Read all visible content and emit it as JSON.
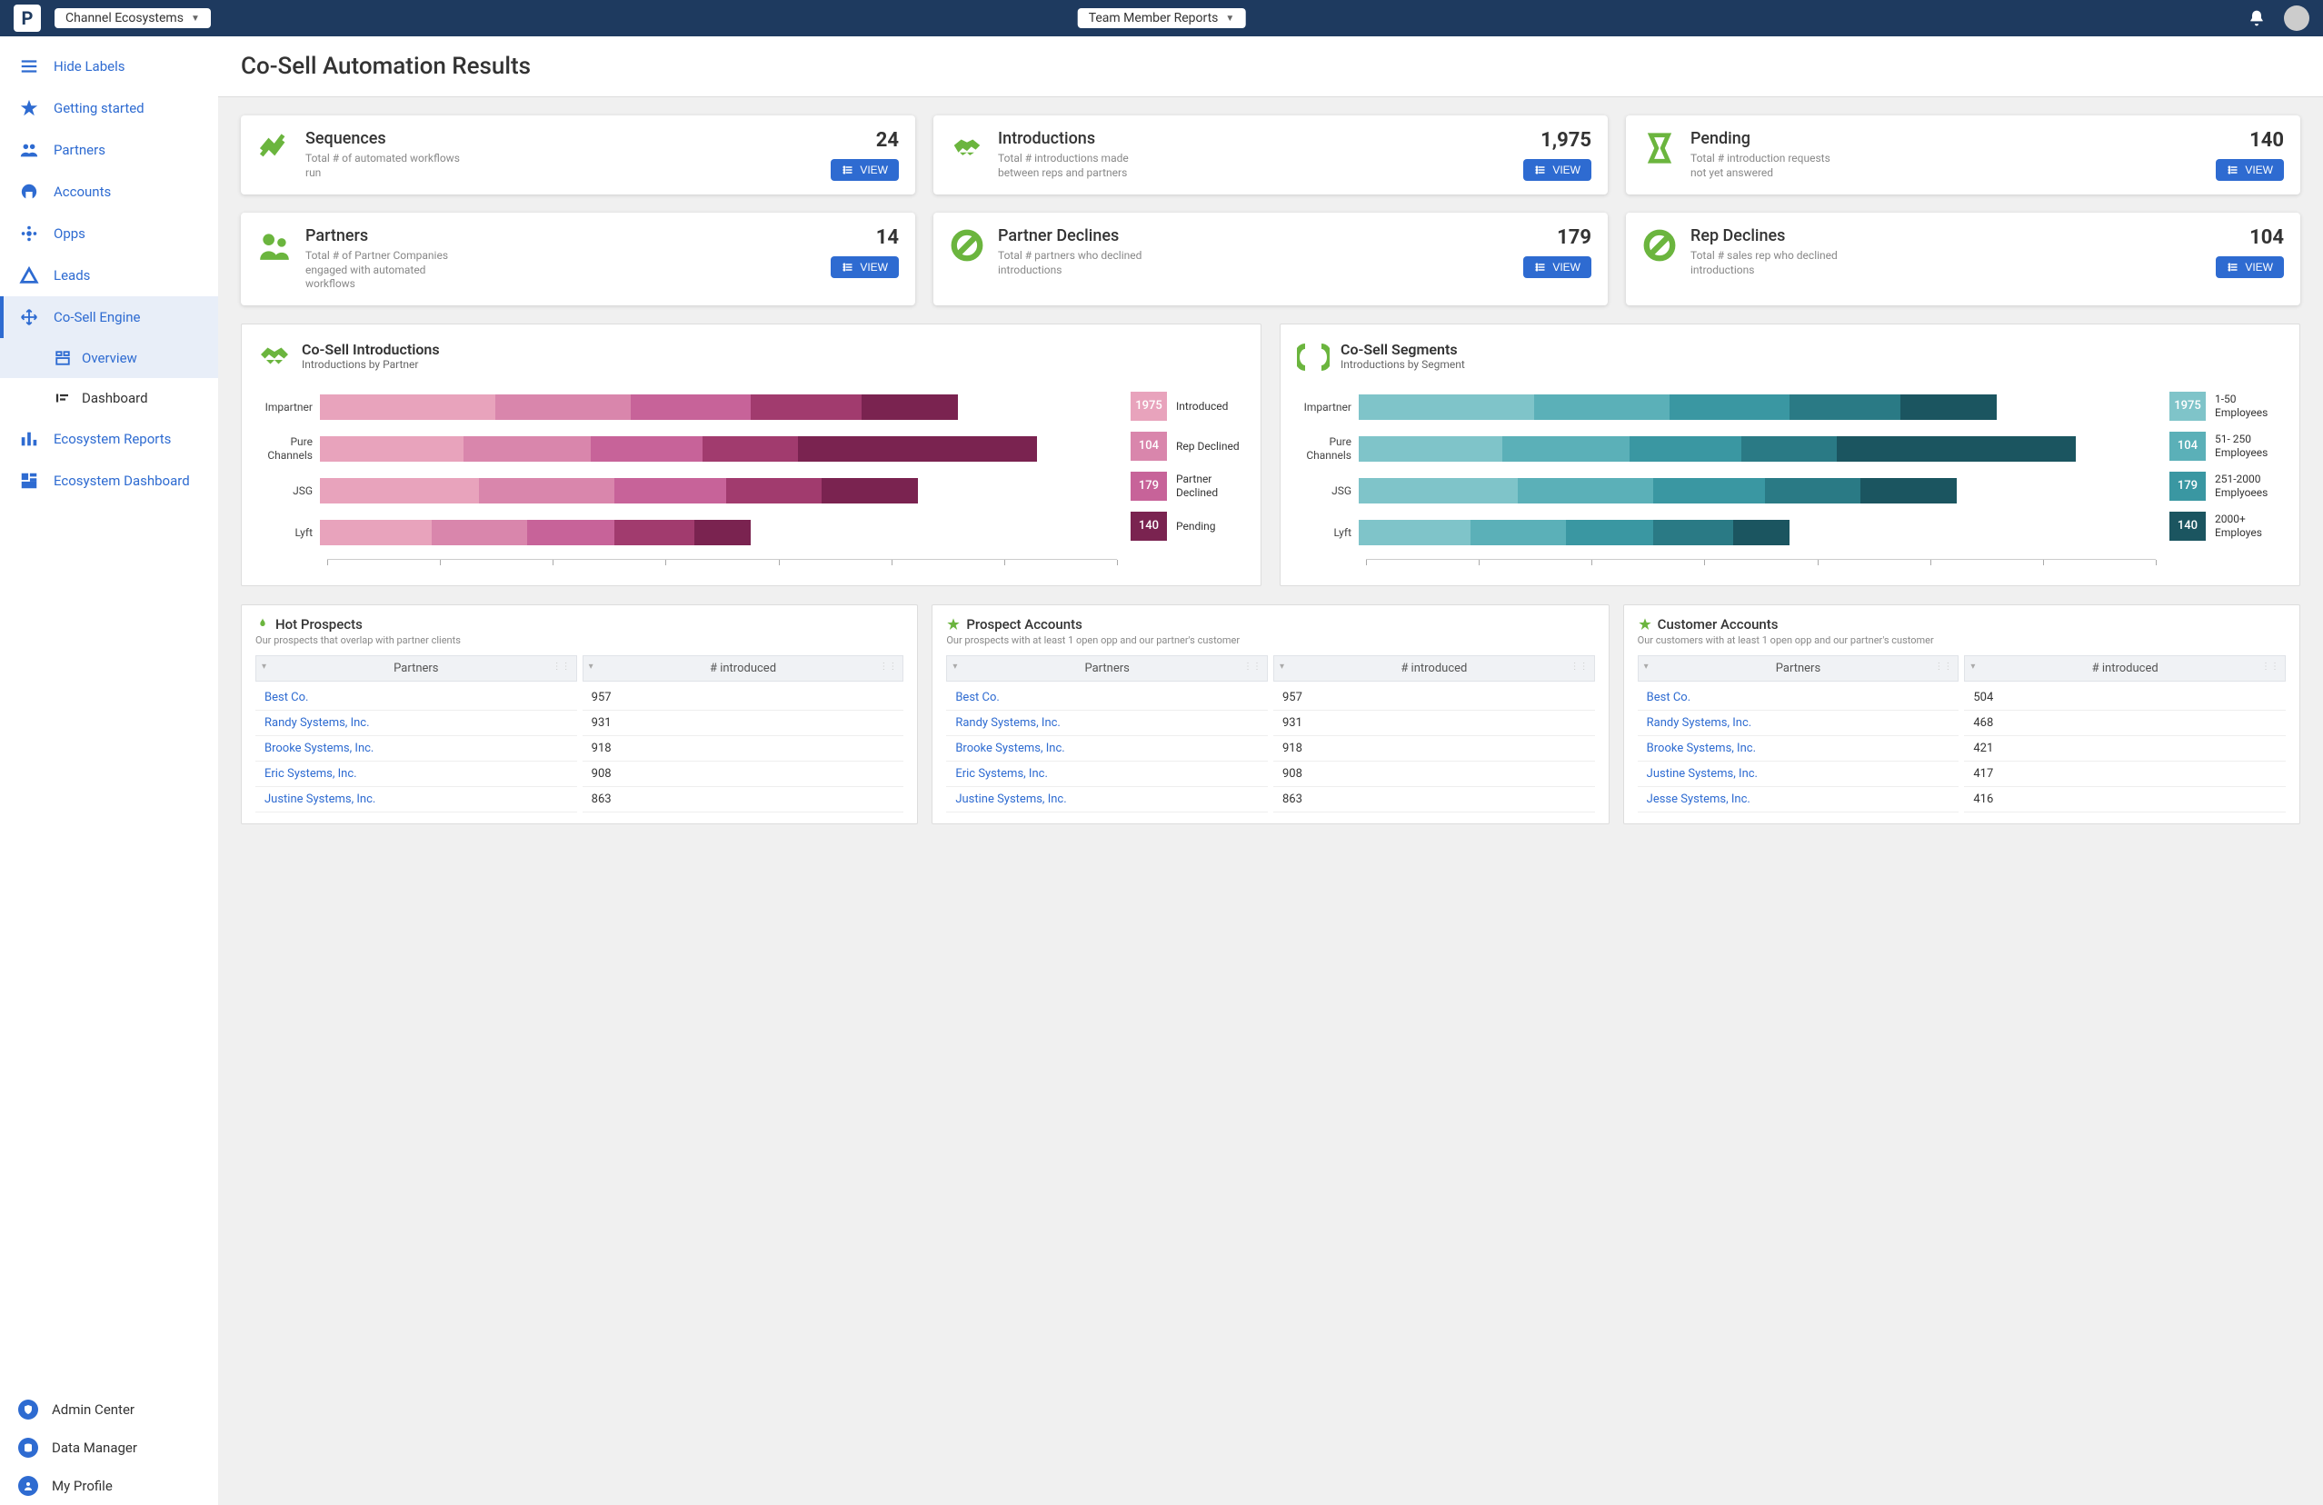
{
  "top": {
    "dropdown1": "Channel Ecosystems",
    "dropdown2": "Team Member Reports"
  },
  "sidebar": {
    "items": [
      {
        "label": "Hide Labels"
      },
      {
        "label": "Getting started"
      },
      {
        "label": "Partners"
      },
      {
        "label": "Accounts"
      },
      {
        "label": "Opps"
      },
      {
        "label": "Leads"
      },
      {
        "label": "Co-Sell Engine"
      },
      {
        "label": "Ecosystem Reports"
      },
      {
        "label": "Ecosystem Dashboard"
      }
    ],
    "subs": [
      {
        "label": "Overview"
      },
      {
        "label": "Dashboard"
      }
    ],
    "bottom": [
      {
        "label": "Admin Center"
      },
      {
        "label": "Data Manager"
      },
      {
        "label": "My Profile"
      }
    ]
  },
  "page_title": "Co-Sell Automation Results",
  "view_label": "VIEW",
  "kpi": [
    {
      "title": "Sequences",
      "desc": "Total # of automated workflows run",
      "value": "24"
    },
    {
      "title": "Introductions",
      "desc": "Total # introductions made between reps and partners",
      "value": "1,975"
    },
    {
      "title": "Pending",
      "desc": "Total # introduction requests not yet answered",
      "value": "140"
    },
    {
      "title": "Partners",
      "desc": "Total # of Partner Companies engaged with automated workflows",
      "value": "14"
    },
    {
      "title": "Partner Declines",
      "desc": "Total # partners who declined introductions",
      "value": "179"
    },
    {
      "title": "Rep Declines",
      "desc": "Total # sales rep who declined introductions",
      "value": "104"
    }
  ],
  "chart1": {
    "title": "Co-Sell Introductions",
    "sub": "Introductions by Partner",
    "legend": [
      {
        "val": "1975",
        "label": "Introduced"
      },
      {
        "val": "104",
        "label": "Rep Declined"
      },
      {
        "val": "179",
        "label": "Partner Declined"
      },
      {
        "val": "140",
        "label": "Pending"
      }
    ]
  },
  "chart2": {
    "title": "Co-Sell Segments",
    "sub": "Introductions by Segment",
    "legend": [
      {
        "val": "1975",
        "label": "1-50 Employees"
      },
      {
        "val": "104",
        "label": "51- 250 Employees"
      },
      {
        "val": "179",
        "label": "251-2000 Emplyoees"
      },
      {
        "val": "140",
        "label": "2000+ Employes"
      }
    ]
  },
  "chart_data": [
    {
      "type": "bar",
      "orientation": "horizontal",
      "stacked": true,
      "title": "Co-Sell Introductions",
      "subtitle": "Introductions by Partner",
      "categories": [
        "Impartner",
        "Pure Channels",
        "JSG",
        "Lyft"
      ],
      "series": [
        {
          "name": "Introduced",
          "values": [
            44,
            36,
            40,
            28
          ]
        },
        {
          "name": "Rep Declined",
          "values": [
            34,
            32,
            34,
            24
          ]
        },
        {
          "name": "Partner Declined",
          "values": [
            30,
            28,
            28,
            22
          ]
        },
        {
          "name": "Pending (light)",
          "values": [
            28,
            24,
            24,
            20
          ]
        },
        {
          "name": "Pending (dark)",
          "values": [
            24,
            60,
            24,
            14
          ]
        }
      ],
      "legend_totals": {
        "Introduced": 1975,
        "Rep Declined": 104,
        "Partner Declined": 179,
        "Pending": 140
      },
      "xrange": [
        0,
        200
      ]
    },
    {
      "type": "bar",
      "orientation": "horizontal",
      "stacked": true,
      "title": "Co-Sell Segments",
      "subtitle": "Introductions by Segment",
      "categories": [
        "Impartner",
        "Pure Channels",
        "JSG",
        "Lyft"
      ],
      "series": [
        {
          "name": "1-50 Employees",
          "values": [
            44,
            36,
            40,
            28
          ]
        },
        {
          "name": "51-250 Employees",
          "values": [
            34,
            32,
            34,
            24
          ]
        },
        {
          "name": "251-2000 Employees",
          "values": [
            30,
            28,
            28,
            22
          ]
        },
        {
          "name": "2000+ light",
          "values": [
            28,
            24,
            24,
            20
          ]
        },
        {
          "name": "2000+ dark",
          "values": [
            24,
            60,
            24,
            14
          ]
        }
      ],
      "legend_totals": {
        "1-50 Employees": 1975,
        "51-250 Employees": 104,
        "251-2000 Employees": 179,
        "2000+ Employees": 140
      },
      "xrange": [
        0,
        200
      ]
    }
  ],
  "tables": [
    {
      "title": "Hot Prospects",
      "desc": "Our prospects that overlap with partner clients",
      "col1": "Partners",
      "col2": "# introduced",
      "rows": [
        {
          "p": "Best Co.",
          "n": "957"
        },
        {
          "p": "Randy Systems, Inc.",
          "n": "931"
        },
        {
          "p": "Brooke Systems, Inc.",
          "n": "918"
        },
        {
          "p": "Eric Systems, Inc.",
          "n": "908"
        },
        {
          "p": "Justine Systems, Inc.",
          "n": "863"
        }
      ]
    },
    {
      "title": "Prospect Accounts",
      "desc": "Our prospects with at least 1 open opp and our partner's customer",
      "col1": "Partners",
      "col2": "# introduced",
      "rows": [
        {
          "p": "Best Co.",
          "n": "957"
        },
        {
          "p": "Randy Systems, Inc.",
          "n": "931"
        },
        {
          "p": "Brooke Systems, Inc.",
          "n": "918"
        },
        {
          "p": "Eric Systems, Inc.",
          "n": "908"
        },
        {
          "p": "Justine Systems, Inc.",
          "n": "863"
        }
      ]
    },
    {
      "title": "Customer Accounts",
      "desc": "Our customers with at least 1 open opp and our partner's customer",
      "col1": "Partners",
      "col2": "# introduced",
      "rows": [
        {
          "p": "Best Co.",
          "n": "504"
        },
        {
          "p": "Randy Systems, Inc.",
          "n": "468"
        },
        {
          "p": "Brooke Systems, Inc.",
          "n": "421"
        },
        {
          "p": "Justine Systems, Inc.",
          "n": "417"
        },
        {
          "p": "Jesse Systems, Inc.",
          "n": "416"
        }
      ]
    }
  ]
}
